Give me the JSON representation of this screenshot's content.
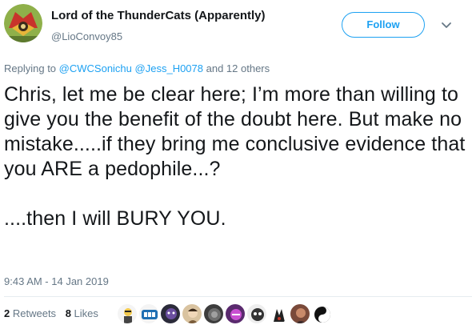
{
  "header": {
    "display_name": "Lord of the ThunderCats (Apparently)",
    "handle": "@LioConvoy85",
    "follow_label": "Follow"
  },
  "reply": {
    "prefix": "Replying to",
    "user1": "@CWCSonichu",
    "user2": "@Jess_H0078",
    "suffix": "and 12 others"
  },
  "tweet": {
    "paragraph1": "Chris, let me be clear here; I’m more than willing to give you the benefit of the doubt here. But make no mistake.....if they bring me conclusive evidence that you ARE a pedophile...?",
    "paragraph2": "....then I will BURY YOU."
  },
  "timestamp": "9:43 AM - 14 Jan 2019",
  "stats": {
    "retweets_count": "2",
    "retweets_label": "Retweets",
    "likes_count": "8",
    "likes_label": "Likes"
  },
  "colors": {
    "accent": "#1da1f2",
    "secondary_text": "#657786",
    "primary_text": "#14171a"
  },
  "icons": {
    "caret": "chevron-down-icon",
    "avatar": "thundercats-avatar",
    "liker_avatars": [
      "avatar-1",
      "avatar-2",
      "avatar-3",
      "avatar-4",
      "avatar-5",
      "avatar-6",
      "avatar-7",
      "avatar-8",
      "avatar-9",
      "avatar-10"
    ]
  }
}
